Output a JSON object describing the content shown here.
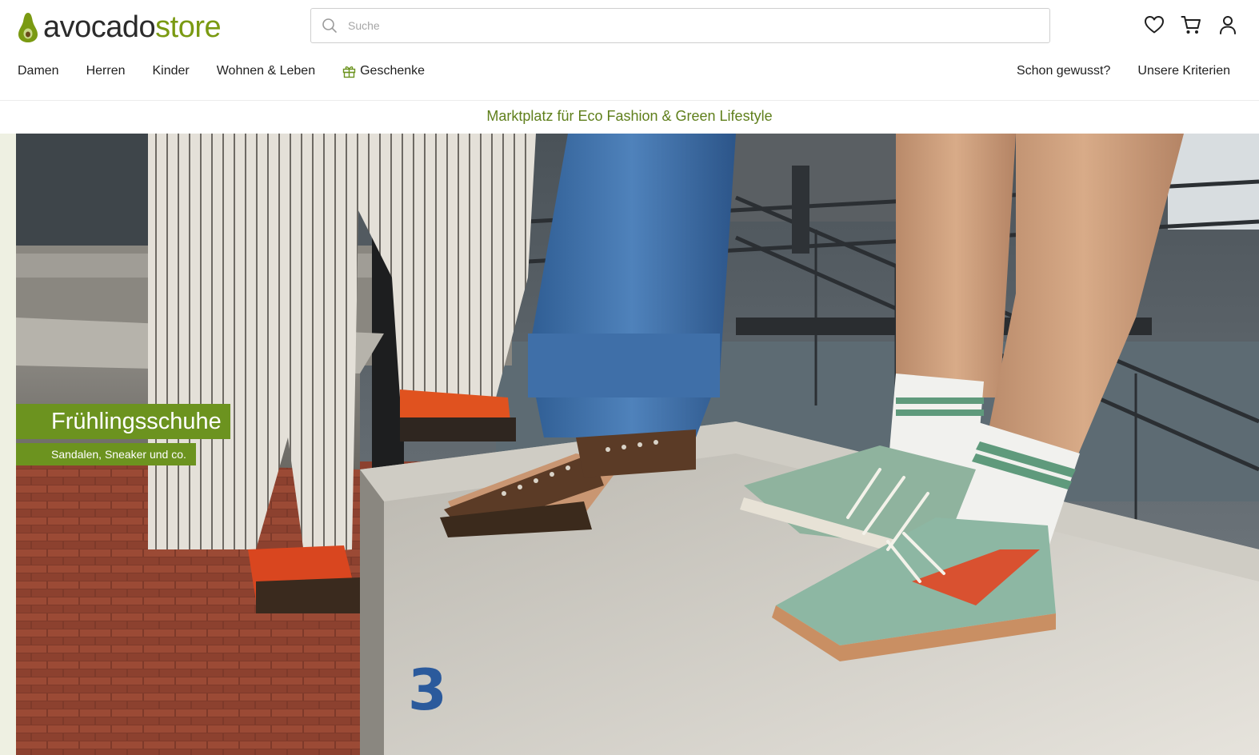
{
  "brand": {
    "part1": "avocado",
    "part2": "store",
    "accent": "#7a9a12"
  },
  "search": {
    "placeholder": "Suche",
    "icon": "search-icon"
  },
  "header_icons": [
    "heart-icon",
    "cart-icon",
    "user-icon"
  ],
  "nav": {
    "left": [
      "Damen",
      "Herren",
      "Kinder",
      "Wohnen & Leben",
      "Geschenke"
    ],
    "right": [
      "Schon gewusst?",
      "Unsere Kriterien"
    ],
    "gift_icon": "gift-icon"
  },
  "tagline": "Marktplatz für Eco Fashion & Green Lifestyle",
  "hero": {
    "title": "Frühlingsschuhe",
    "subtitle": "Sandalen, Sneaker und co.",
    "banner_color": "#6c931f"
  }
}
